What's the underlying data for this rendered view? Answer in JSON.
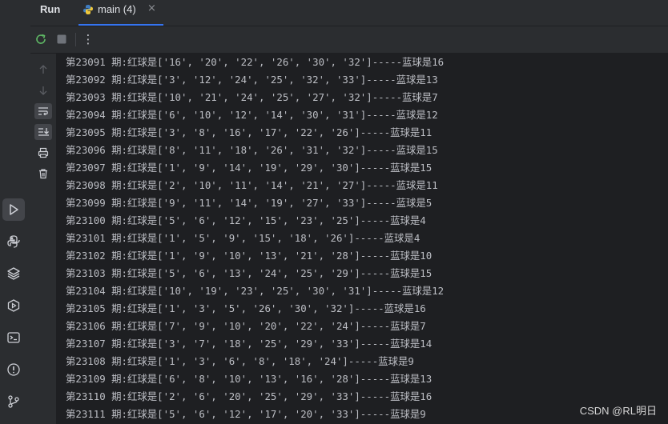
{
  "tool_window": {
    "title": "Run"
  },
  "tab": {
    "label": "main (4)",
    "close": "×"
  },
  "toolbar": {
    "more": "⋮"
  },
  "console": {
    "lines": [
      "第23091 期:红球是['16', '20', '22', '26', '30', '32']-----蓝球是16",
      "第23092 期:红球是['3', '12', '24', '25', '32', '33']-----蓝球是13",
      "第23093 期:红球是['10', '21', '24', '25', '27', '32']-----蓝球是7",
      "第23094 期:红球是['6', '10', '12', '14', '30', '31']-----蓝球是12",
      "第23095 期:红球是['3', '8', '16', '17', '22', '26']-----蓝球是11",
      "第23096 期:红球是['8', '11', '18', '26', '31', '32']-----蓝球是15",
      "第23097 期:红球是['1', '9', '14', '19', '29', '30']-----蓝球是15",
      "第23098 期:红球是['2', '10', '11', '14', '21', '27']-----蓝球是11",
      "第23099 期:红球是['9', '11', '14', '19', '27', '33']-----蓝球是5",
      "第23100 期:红球是['5', '6', '12', '15', '23', '25']-----蓝球是4",
      "第23101 期:红球是['1', '5', '9', '15', '18', '26']-----蓝球是4",
      "第23102 期:红球是['1', '9', '10', '13', '21', '28']-----蓝球是10",
      "第23103 期:红球是['5', '6', '13', '24', '25', '29']-----蓝球是15",
      "第23104 期:红球是['10', '19', '23', '25', '30', '31']-----蓝球是12",
      "第23105 期:红球是['1', '3', '5', '26', '30', '32']-----蓝球是16",
      "第23106 期:红球是['7', '9', '10', '20', '22', '24']-----蓝球是7",
      "第23107 期:红球是['3', '7', '18', '25', '29', '33']-----蓝球是14",
      "第23108 期:红球是['1', '3', '6', '8', '18', '24']-----蓝球是9",
      "第23109 期:红球是['6', '8', '10', '13', '16', '28']-----蓝球是13",
      "第23110 期:红球是['2', '6', '20', '25', '29', '33']-----蓝球是16",
      "第23111 期:红球是['5', '6', '12', '17', '20', '33']-----蓝球是9"
    ]
  },
  "watermark": "CSDN @RL明日",
  "icons": {
    "left_bar": [
      "run-icon",
      "python-console-icon",
      "layers-icon",
      "services-icon",
      "terminal-icon",
      "problems-icon",
      "git-icon"
    ],
    "gutter": [
      "up-arrow-icon",
      "down-arrow-icon",
      "soft-wrap-icon",
      "scroll-to-end-icon",
      "print-icon",
      "trash-icon"
    ],
    "toolbar": [
      "rerun-icon",
      "stop-icon",
      "more-icon"
    ]
  },
  "colors": {
    "accent": "#3574f0",
    "rerun": "#5fb865",
    "text": "#bcbec4",
    "background": "#1e1f22",
    "panel": "#2b2d30"
  }
}
